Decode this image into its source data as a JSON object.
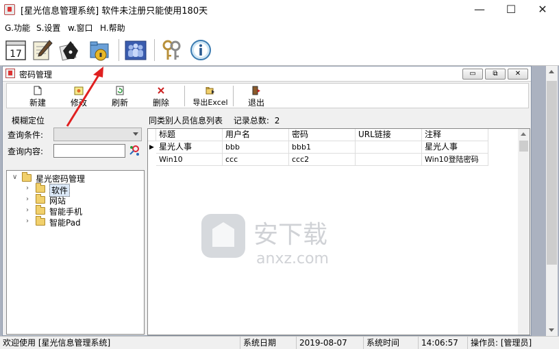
{
  "window": {
    "title": "[星光信息管理系统]  软件未注册只能使用180天",
    "minimize_glyph": "—",
    "maximize_glyph": "☐",
    "close_glyph": "✕"
  },
  "menu": [
    "G.功能",
    "S.设置",
    "w.窗口",
    "H.帮助"
  ],
  "main_toolbar": {
    "icons": [
      "calendar-icon",
      "notepad-pen-icon",
      "pen-nib-icon",
      "lock-folder-icon",
      "users-group-icon",
      "keys-icon",
      "info-icon"
    ],
    "calendar_day": "17"
  },
  "child_window": {
    "title": "密码管理",
    "buttons": {
      "minimize": "▭",
      "restore": "⧉",
      "close": "✕"
    }
  },
  "child_toolbar": {
    "new": "新建",
    "edit": "修改",
    "refresh": "刷新",
    "delete": "删除",
    "export": "导出Excel",
    "exit": "退出"
  },
  "filter": {
    "section": "模糊定位",
    "condition_label": "查询条件:",
    "content_label": "查询内容:",
    "condition_value": "",
    "content_value": ""
  },
  "tree": [
    {
      "label": "星光密码管理",
      "toggle": "∨",
      "level": 0,
      "selected": false
    },
    {
      "label": "软件",
      "toggle": "›",
      "level": 1,
      "selected": true
    },
    {
      "label": "网站",
      "toggle": "›",
      "level": 1,
      "selected": false
    },
    {
      "label": "智能手机",
      "toggle": "›",
      "level": 1,
      "selected": false
    },
    {
      "label": "智能Pad",
      "toggle": "›",
      "level": 1,
      "selected": false
    }
  ],
  "grid": {
    "caption": "同类别人员信息列表",
    "count_label": "记录总数:",
    "count": "2",
    "headers": [
      "标题",
      "用户名",
      "密码",
      "URL链接",
      "注释"
    ],
    "rows": [
      {
        "current": true,
        "cells": [
          "星光人事",
          "bbb",
          "bbb1",
          "",
          "星光人事"
        ]
      },
      {
        "current": false,
        "cells": [
          "Win10",
          "ccc",
          "ccc2",
          "",
          "Win10登陆密码"
        ]
      }
    ]
  },
  "status": {
    "welcome": "欢迎使用 [星光信息管理系统]",
    "date_label": "系统日期",
    "date": "2019-08-07",
    "time_label": "系统时间",
    "time": "14:06:57",
    "operator_label": "操作员:",
    "operator": "[管理员]"
  },
  "colors": {
    "mdi_background": "#abb2c0",
    "annotation_arrow": "#e02020",
    "selection": "#dbe8f7"
  },
  "watermark": {
    "text": "安下载",
    "sub": "anxz.com"
  }
}
